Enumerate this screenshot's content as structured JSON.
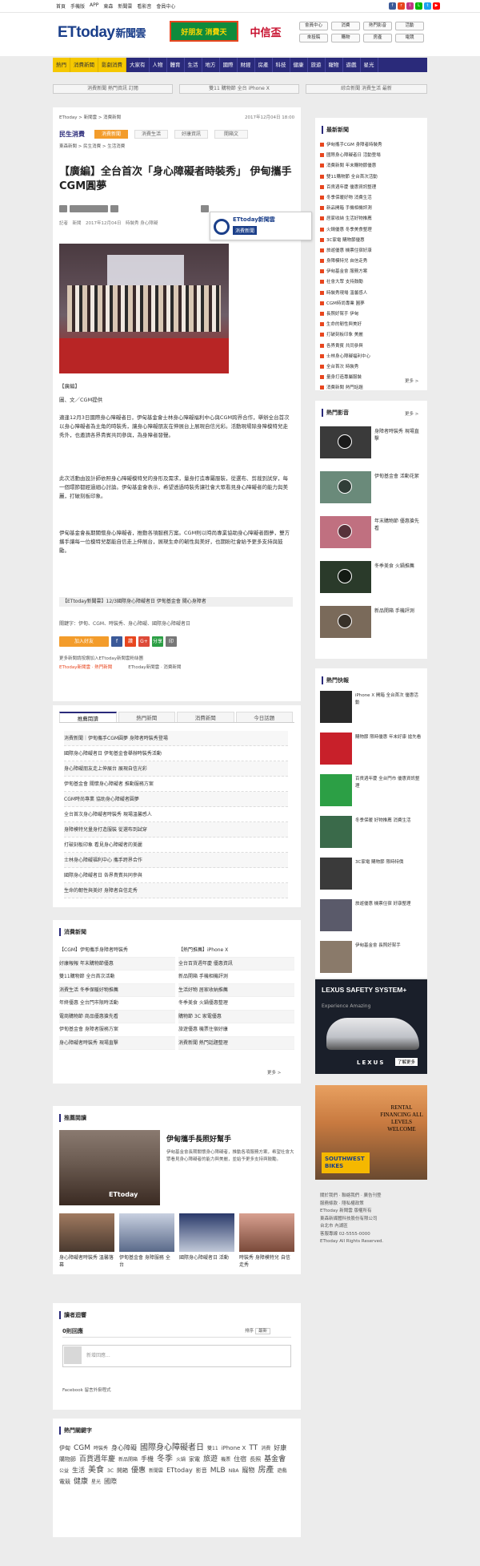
{
  "topbar": {
    "links": [
      "首頁",
      "手機版",
      "APP",
      "東森",
      "新聞雲",
      "看影音",
      "會員中心"
    ],
    "social_colors": [
      "#3b5998",
      "#e8461e",
      "#c13584",
      "#00b900",
      "#1da1f2",
      "#ff0000"
    ]
  },
  "header": {
    "logo_main": "ETtoday",
    "logo_sub": "新聞雲",
    "ad1": "好朋友 消費天",
    "ad2": "中信盃",
    "quick": [
      "會員中心",
      "消費",
      "熱門影音",
      "活動",
      "來投稿",
      "購物",
      "房產",
      "電競"
    ]
  },
  "nav": {
    "hot": [
      "熱門",
      "消費新聞",
      "影劇消費"
    ],
    "items": [
      "大家有",
      "人物",
      "體育",
      "生活",
      "地方",
      "國際",
      "財經",
      "房產",
      "科技",
      "健康",
      "旅遊",
      "寵物",
      "遊戲",
      "星光",
      "影音",
      "新奇",
      "論壇"
    ]
  },
  "promos": [
    "消費新聞 熱門資訊 訂閱",
    "雙11 購物節 全台 iPhone X",
    "綜合新聞 消費生活 最新"
  ],
  "article": {
    "breadcrumb": "ETtoday > 新聞雲 > 消費新聞",
    "date": "2017年12月04日 18:00",
    "section": "民生消費",
    "tabs": [
      "消費新聞",
      "消費生活",
      "好康資訊",
      "開箱文"
    ],
    "subcrumb": "東森新聞 > 民生消費 > 生活消費",
    "title": "【廣編】全台首次「身心障礙者時裝秀」 伊甸攜手CGM圓夢",
    "tagline": "記者　新聞　2017年12月04日　時裝秀 身心障礙",
    "caption": "【廣編】",
    "paragraphs": [
      "圖、文／CGM提供",
      "適逢12月3日國際身心障礙者日，伊甸基金會士林身心障礙福利中心與CGM跨界合作，舉辦全台首次以身心障礙者為主角的時裝秀，讓身心障礙朋友在伸展台上展現自信光彩。活動現場除身障模特兒走秀外，也邀請各界貴賓共同參與，為身障者發聲。",
      "此次活動由設計師依照身心障礙模特兒的身形及需求，量身打造專屬服裝，從選布、剪裁到試穿，每一個環節都經過細心討論。伊甸基金會表示，希望透過時裝秀讓社會大眾看見身心障礙者的能力與美麗，打破刻板印象。",
      "伊甸基金會長期關懷身心障礙者，推動各項服務方案。CGM則以時尚專業協助身心障礙者圓夢，雙方攜手讓每一位模特兒都能自信走上伸展台，展現生命的韌性與美好，也期盼社會給予更多支持與鼓勵。"
    ],
    "promo_strip": "【ETtoday新聞雲】12/3國際身心障礙者日 伊甸基金會 關心身障者",
    "keywords": "關鍵字：伊甸、CGM、時裝秀、身心障礙、國際身心障礙者日",
    "share": [
      "加入好友",
      "f",
      "讚",
      "G+",
      "分享",
      "印"
    ],
    "tiny1": "更多新聞請按讚加入ETtoday新聞雲粉絲團",
    "tiny2a": "ETtoday新聞雲 ‧ 熱門新聞",
    "tiny2b": "ETtoday新聞雲 ‧ 消費新聞"
  },
  "float_ad": {
    "title": "ETtoday新聞雲",
    "sub": "消費新聞"
  },
  "related": {
    "tabs": [
      "推薦閱讀",
      "熱門新聞",
      "消費新聞",
      "今日話題"
    ],
    "items": [
      "消費新聞｜伊甸攜手CGM圓夢 身障者時裝秀登場",
      "國際身心障礙者日 伊甸基金會舉辦時裝秀活動",
      "身心障礙朋友走上伸展台 展現自信光彩",
      "伊甸基金會 關懷身心障礙者 推動服務方案",
      "CGM時尚專業 協助身心障礙者圓夢",
      "全台首次身心障礙者時裝秀 現場溫馨感人",
      "身障模特兒量身打造服裝 從選布到試穿",
      "打破刻板印象 看見身心障礙者的美麗",
      "士林身心障礙福利中心 攜手跨界合作",
      "國際身心障礙者日 各界貴賓共同參與",
      "生命的韌性與美好 身障者自信走秀",
      "社會大眾支持鼓勵 身障者圓夢計畫"
    ]
  },
  "consume": {
    "title": "消費新聞",
    "left": [
      "【CGM】伊甸攜手身障者時裝秀",
      "好康報報 年末購物節優惠",
      "雙11購物節 全台首次活動",
      "消費生活 冬季保暖好物推薦",
      "年終優惠 全台門市限時活動",
      "電商購物節 商品優惠搶先看",
      "伊甸基金會 身障者服務方案",
      "身心障礙者時裝秀 現場直擊"
    ],
    "right": [
      "【熱門推薦】iPhone X",
      "全台百貨週年慶 優惠資訊",
      "新品開箱 手機相機評測",
      "生活好物 居家收納推薦",
      "冬季美食 火鍋優惠整理",
      "購物節 3C 家電優惠",
      "旅遊優惠 機票住宿好康",
      "消費新聞 熱門話題整理"
    ],
    "more": "更多 >"
  },
  "recommend": {
    "title": "推薦閱讀",
    "watermark": "ETtoday",
    "headline": "伊甸攜手長照好幫手",
    "desc": "伊甸基金會長期關懷身心障礙者，推動各項服務方案，希望社會大眾看見身心障礙者的能力與美麗，並給予更多支持與鼓勵。",
    "thumbs": [
      "身心障礙者時裝秀 溫馨落幕",
      "伊甸基金會 身障服務 全台",
      "國際身心障礙者日 活動",
      "時裝秀 身障模特兒 自信走秀"
    ]
  },
  "comment": {
    "title": "讀者迴響",
    "count_label": "0則回應",
    "sort": "排序",
    "sort_value": "最新",
    "placeholder": "新增回應...",
    "plugin": "Facebook 留言外掛程式"
  },
  "hotkw": {
    "title": "熱門關鍵字",
    "words": [
      "伊甸",
      "CGM",
      "時裝秀",
      "身心障礙",
      "國際身心障礙者日",
      "雙11",
      "iPhone X",
      "TT",
      "消費",
      "好康",
      "購物節",
      "百貨週年慶",
      "新品開箱",
      "手機",
      "冬季",
      "火鍋",
      "家電",
      "旅遊",
      "機票",
      "住宿",
      "長照",
      "基金會",
      "公益",
      "生活",
      "美食",
      "3C",
      "開箱",
      "優惠",
      "新聞雲",
      "ETtoday",
      "影音",
      "MLB",
      "NBA",
      "寵物",
      "房產",
      "遊戲",
      "電競",
      "健康",
      "星光",
      "國際"
    ]
  },
  "latest": {
    "title": "最新新聞",
    "items": [
      "伊甸攜手CGM 身障者時裝秀",
      "國際身心障礙者日 活動登場",
      "消費新聞 年末購物節優惠",
      "雙11購物節 全台首次活動",
      "百貨週年慶 優惠資訊整理",
      "冬季保暖好物 消費生活",
      "新品開箱 手機相機評測",
      "居家收納 生活好物推薦",
      "火鍋優惠 冬季美食整理",
      "3C家電 購物節優惠",
      "旅遊優惠 機票住宿好康",
      "身障模特兒 自信走秀",
      "伊甸基金會 服務方案",
      "社會大眾 支持鼓勵",
      "時裝秀現場 溫馨感人",
      "CGM時尚專業 圓夢",
      "長照好幫手 伊甸",
      "生命的韌性與美好",
      "打破刻板印象 美麗",
      "各界貴賓 共同參與",
      "士林身心障礙福利中心",
      "全台首次 時裝秀",
      "量身打造專屬服裝",
      "消費新聞 熱門話題"
    ],
    "more": "更多 >"
  },
  "video": {
    "title": "熱門影音",
    "items": [
      "身障者時裝秀 現場直擊",
      "伊甸基金會 活動花絮",
      "年末購物節 優惠搶先看",
      "冬季美食 火鍋推薦",
      "新品開箱 手機評測"
    ],
    "more": "更多 >"
  },
  "pop": {
    "title": "熱門快報",
    "items": [
      "iPhone X 開箱 全台首次 優惠活動",
      "購物節 限時優惠 年末好康 搶先看",
      "百貨週年慶 全台門市 優惠資訊整理",
      "冬季保暖 好物推薦 消費生活",
      "3C家電 購物節 限時特價",
      "旅遊優惠 機票住宿 好康整理",
      "伊甸基金會 長照好幫手"
    ]
  },
  "ad_lexus": {
    "t1": "LEXUS SAFETY SYSTEM+",
    "t2": "Experience Amazing",
    "brand": "LEXUS",
    "btn": "了解更多"
  },
  "ad_bikes": {
    "t": "RENTAL FINANCING ALL LEVELS WELCOME",
    "sb": "SOUTHWEST BIKES"
  },
  "footer": {
    "lines": [
      "關於我們 ‧ 聯絡我們 ‧ 廣告刊登",
      "服務條款 ‧ 隱私權政策",
      "ETtoday 新聞雲 版權所有",
      "東森新媒體科技股份有限公司",
      "台北市 內湖區",
      "客服專線 02-5555-0000",
      "ETtoday All Rights Reserved."
    ]
  }
}
